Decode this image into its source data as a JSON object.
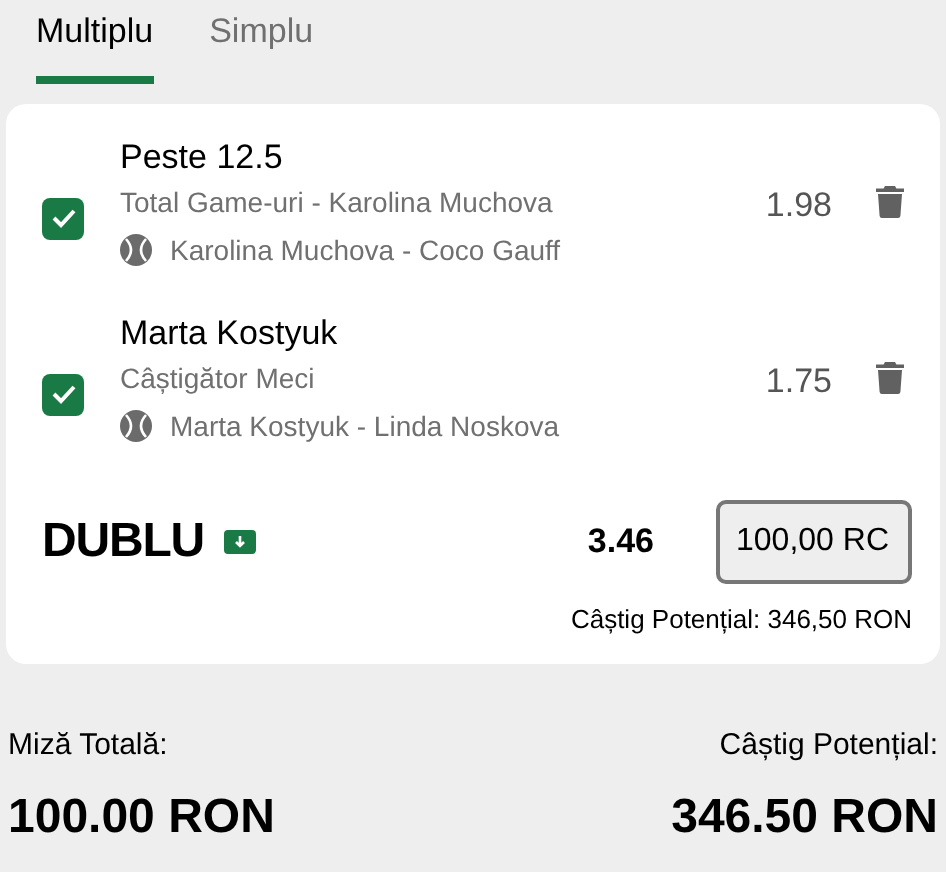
{
  "tabs": [
    {
      "label": "Multiplu",
      "selected": true
    },
    {
      "label": "Simplu",
      "selected": false
    }
  ],
  "selections": [
    {
      "title": "Peste 12.5",
      "market": "Total Game-uri - Karolina Muchova",
      "event": "Karolina Muchova - Coco Gauff",
      "odds": "1.98",
      "checked": true
    },
    {
      "title": "Marta Kostyuk",
      "market": "Câștigător Meci",
      "event": "Marta Kostyuk - Linda Noskova",
      "odds": "1.75",
      "checked": true
    }
  ],
  "bet": {
    "type": "DUBLU",
    "total_odds": "3.46",
    "stake": "100,00 RC",
    "potential_win": "Câștig Potențial: 346,50 RON"
  },
  "summary": {
    "stake_label": "Miză Totală:",
    "stake_value": "100.00 RON",
    "win_label": "Câștig Potențial:",
    "win_value": "346.50 RON"
  }
}
